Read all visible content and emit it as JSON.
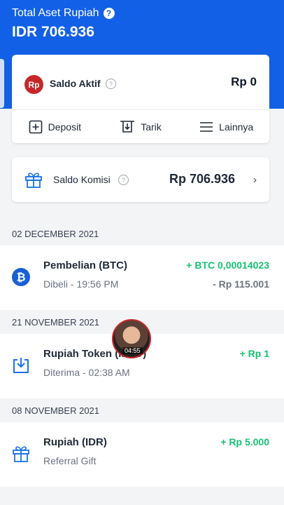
{
  "header": {
    "total_label": "Total Aset Rupiah",
    "total_value": "IDR 706.936",
    "help_icon": "question-circle-icon"
  },
  "saldo_aktif": {
    "logo": "Rp",
    "label": "Saldo Aktif",
    "help": "?",
    "value": "Rp 0"
  },
  "actions": [
    {
      "label": "Deposit",
      "icon": "deposit-plus-icon"
    },
    {
      "label": "Tarik",
      "icon": "withdraw-icon"
    },
    {
      "label": "Lainnya",
      "icon": "menu-icon"
    }
  ],
  "komisi": {
    "label": "Saldo Komisi",
    "help": "?",
    "value": "Rp 706.936",
    "chevron": "›"
  },
  "groups": [
    {
      "date": "02 DECEMBER 2021",
      "tx": {
        "title": "Pembelian (BTC)",
        "subtitle": "Dibeli - 19:56 PM",
        "amount": "+ BTC 0,00014023",
        "amount2": "- Rp 115.001",
        "icon": "bitcoin-icon"
      }
    },
    {
      "date": "21 NOVEMBER 2021",
      "tx": {
        "title": "Rupiah Token (IDRT)",
        "subtitle": "Diterima - 02:38 AM",
        "amount": "+ Rp 1",
        "icon": "receive-download-icon"
      }
    },
    {
      "date": "08 NOVEMBER 2021",
      "tx": {
        "title": "Rupiah (IDR)",
        "subtitle": "Referral Gift",
        "amount": "+ Rp 5.000",
        "icon": "gift-icon"
      }
    }
  ],
  "overlay": {
    "time": "04:55"
  },
  "colors": {
    "primary": "#1260e6",
    "positive": "#16c172",
    "logo_red": "#c62828"
  }
}
